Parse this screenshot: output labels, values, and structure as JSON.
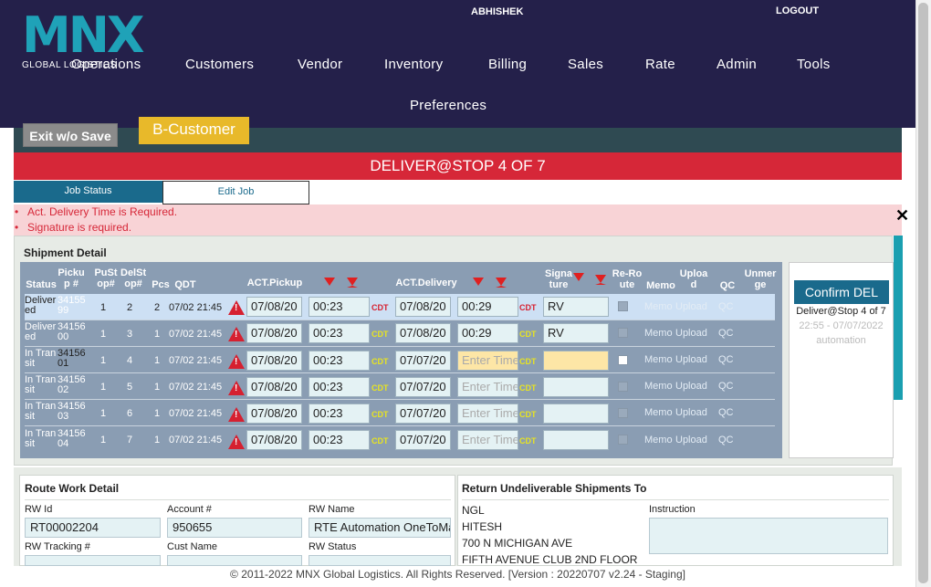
{
  "header": {
    "logo_text": "MNX",
    "logo_sub": "GLOBAL LOGISTICS",
    "user": "ABHISHEK",
    "logout": "LOGOUT",
    "menu": [
      "Operations",
      "Customers",
      "Vendor",
      "Inventory",
      "Billing",
      "Sales",
      "Rate",
      "Admin",
      "Tools",
      "Preferences"
    ]
  },
  "toolbar": {
    "exit_label": "Exit w/o Save",
    "bcust_label": "B-Customer"
  },
  "banner": "DELIVER@STOP 4 OF 7",
  "tabs": {
    "job_status": "Job Status",
    "edit_job": "Edit Job"
  },
  "errors": [
    "Act. Delivery Time is Required.",
    "Signature is required."
  ],
  "shipment": {
    "title": "Shipment Detail",
    "headers": {
      "status": "Status",
      "pickup": "Picku p #",
      "pustop": "PuSt op#",
      "delstop": "DelSt op#",
      "pcs": "Pcs",
      "qdt": "QDT",
      "act_pickup": "ACT.Pickup",
      "act_delivery": "ACT.Delivery",
      "signature": "Signa ture",
      "reroute": "Re-Ro ute",
      "memo": "Memo",
      "upload": "Uploa d",
      "qc": "QC",
      "unmerge": "Unmer ge"
    },
    "rows": [
      {
        "status": "Deliver ed",
        "pickup": "34155 99",
        "pustop": "1",
        "delstop": "2",
        "pcs": "2",
        "qdt": "07/02 21:45",
        "pu_date": "07/08/20",
        "pu_time": "00:23",
        "pu_tz": "CDT",
        "del_date": "07/08/20",
        "del_time": "00:29",
        "del_tz": "CDT",
        "signature": "RV",
        "memo": "Memo",
        "upload": "Upload",
        "qc": "QC"
      },
      {
        "status": "Deliver ed",
        "pickup": "34156 00",
        "pustop": "1",
        "delstop": "3",
        "pcs": "1",
        "qdt": "07/02 21:45",
        "pu_date": "07/08/20",
        "pu_time": "00:23",
        "pu_tz": "CDT",
        "del_date": "07/08/20",
        "del_time": "00:29",
        "del_tz": "CDT",
        "signature": "RV",
        "memo": "Memo",
        "upload": "Upload",
        "qc": "QC"
      },
      {
        "status": "In Tran sit",
        "pickup": "34156 01",
        "pustop": "1",
        "delstop": "4",
        "pcs": "1",
        "qdt": "07/02 21:45",
        "pu_date": "07/08/20",
        "pu_time": "00:23",
        "pu_tz": "CDT",
        "del_date": "07/07/20",
        "del_time": "Enter Time",
        "del_tz": "CDT",
        "signature": "",
        "memo": "Memo",
        "upload": "Upload",
        "qc": "QC"
      },
      {
        "status": "In Tran sit",
        "pickup": "34156 02",
        "pustop": "1",
        "delstop": "5",
        "pcs": "1",
        "qdt": "07/02 21:45",
        "pu_date": "07/08/20",
        "pu_time": "00:23",
        "pu_tz": "CDT",
        "del_date": "07/07/20",
        "del_time": "Enter Time",
        "del_tz": "CDT",
        "signature": "",
        "memo": "Memo",
        "upload": "Upload",
        "qc": "QC"
      },
      {
        "status": "In Tran sit",
        "pickup": "34156 03",
        "pustop": "1",
        "delstop": "6",
        "pcs": "1",
        "qdt": "07/02 21:45",
        "pu_date": "07/08/20",
        "pu_time": "00:23",
        "pu_tz": "CDT",
        "del_date": "07/07/20",
        "del_time": "Enter Time",
        "del_tz": "CDT",
        "signature": "",
        "memo": "Memo",
        "upload": "Upload",
        "qc": "QC"
      },
      {
        "status": "In Tran sit",
        "pickup": "34156 04",
        "pustop": "1",
        "delstop": "7",
        "pcs": "1",
        "qdt": "07/02 21:45",
        "pu_date": "07/08/20",
        "pu_time": "00:23",
        "pu_tz": "CDT",
        "del_date": "07/07/20",
        "del_time": "Enter Time",
        "del_tz": "CDT",
        "signature": "",
        "memo": "Memo",
        "upload": "Upload",
        "qc": "QC"
      }
    ]
  },
  "confirm": {
    "button": "Confirm DEL",
    "line1": "Deliver@Stop 4 of 7",
    "line2": "22:55 - 07/07/2022",
    "line3": "automation"
  },
  "route": {
    "title": "Route Work Detail",
    "rw_id_label": "RW Id",
    "rw_id": "RT00002204",
    "account_label": "Account #",
    "account": "950655",
    "rw_name_label": "RW Name",
    "rw_name": "RTE Automation OneToMany",
    "rw_tracking_label": "RW Tracking #",
    "cust_name_label": "Cust Name",
    "rw_status_label": "RW Status"
  },
  "return": {
    "title": "Return Undeliverable Shipments To",
    "lines": [
      "NGL",
      "HITESH",
      "700 N MICHIGAN AVE",
      "FIFTH AVENUE CLUB 2ND FLOOR"
    ],
    "instruction_label": "Instruction"
  },
  "footer": "© 2011-2022 MNX Global Logistics. All Rights Reserved. [Version : 20220707 v2.24 - Staging]"
}
